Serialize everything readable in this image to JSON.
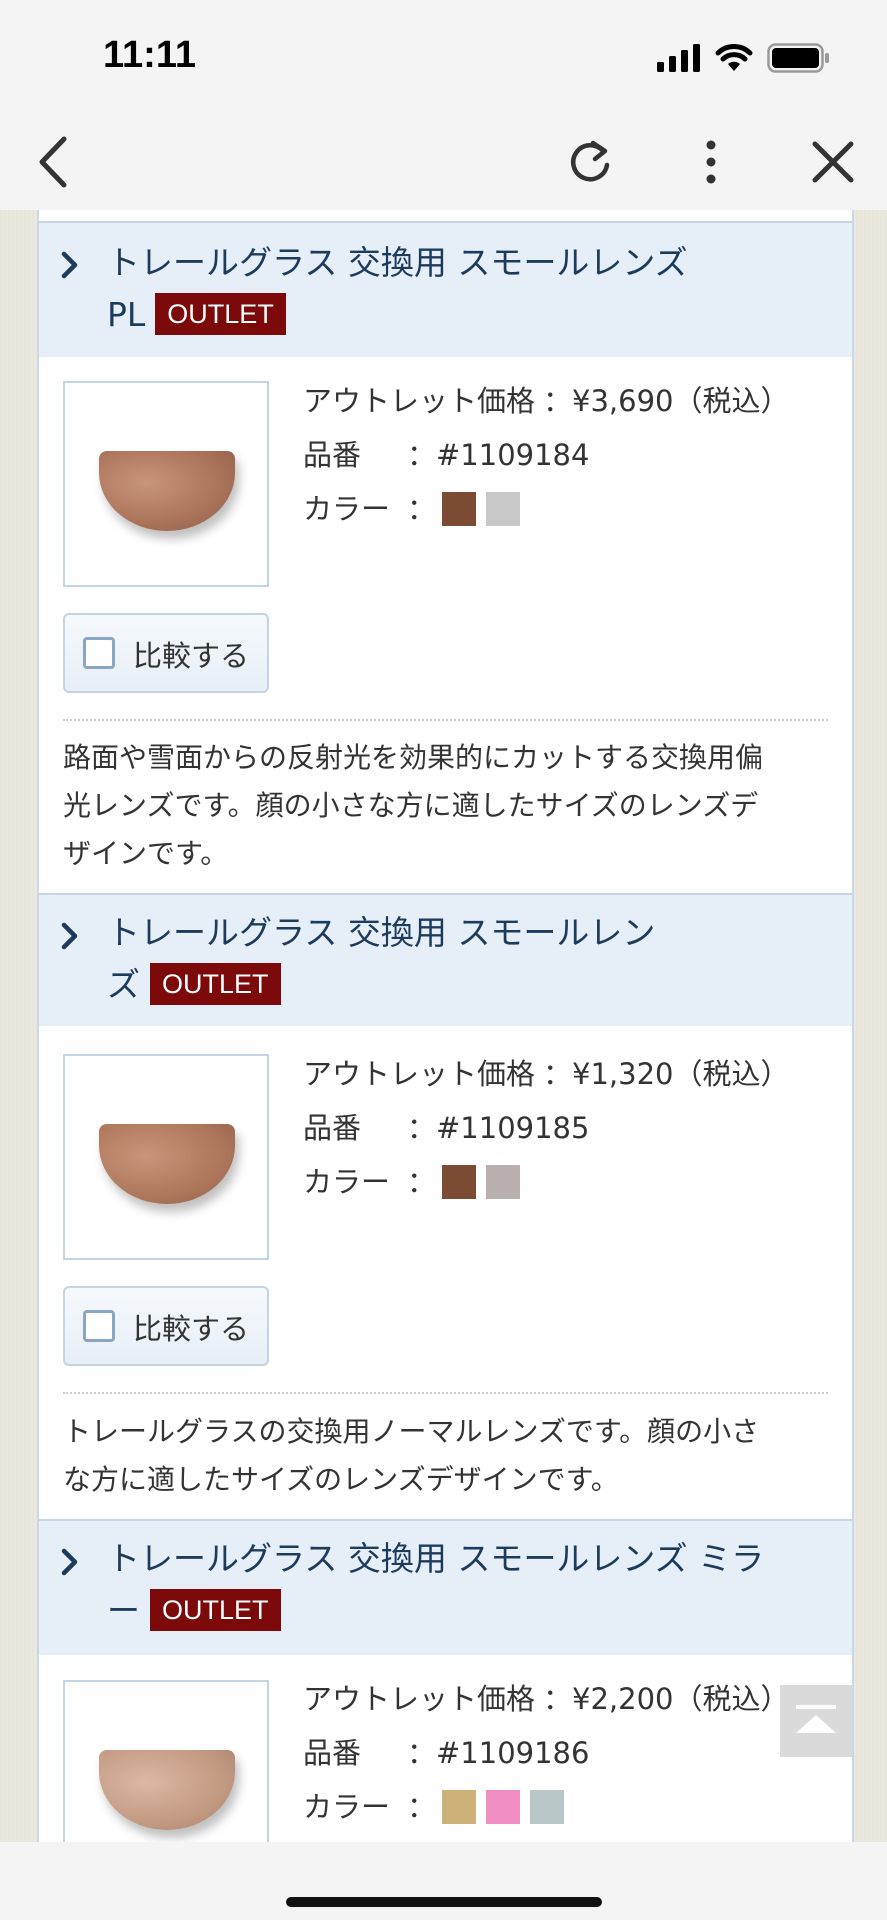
{
  "status": {
    "time": "11:11"
  },
  "items": [
    {
      "title": "トレールグラス 交換用 スモールレンズ",
      "title_line2": "PL",
      "badge": "OUTLET",
      "price_label": "アウトレット価格",
      "price": "：¥3,690（税込）",
      "sku_label": "品番",
      "sku": "：#1109184",
      "color_label": "カラー",
      "color_sep": "：",
      "colors": [
        "#7b4b34",
        "#c8c8c8"
      ],
      "compare_label": "比較する",
      "desc_line1": "路面や雪面からの反射光を効果的にカットする交換用偏",
      "desc_line2": "光レンズです。顔の小さな方に適したサイズのレンズデ",
      "desc_line3": "ザインです。",
      "lens_color": "#b07a62"
    },
    {
      "title": "トレールグラス 交換用 スモールレン",
      "title_line2": "ズ",
      "badge": "OUTLET",
      "price_label": "アウトレット価格",
      "price": "：¥1,320（税込）",
      "sku_label": "品番",
      "sku": "：#1109185",
      "color_label": "カラー",
      "color_sep": "：",
      "colors": [
        "#7b4b34",
        "#b9afae"
      ],
      "compare_label": "比較する",
      "desc_line1": "トレールグラスの交換用ノーマルレンズです。顔の小さ",
      "desc_line2": "な方に適したサイズのレンズデザインです。",
      "lens_color": "#b58064"
    },
    {
      "title": "トレールグラス 交換用 スモールレンズ ミラ",
      "title_line2": "ー",
      "badge": "OUTLET",
      "price_label": "アウトレット価格",
      "price": "：¥2,200（税込）",
      "sku_label": "品番",
      "sku": "：#1109186",
      "color_label": "カラー",
      "color_sep": "：",
      "colors": [
        "#cdb179",
        "#f08dc3",
        "#b9c7c8"
      ],
      "lens_color": "#c99f87"
    }
  ]
}
